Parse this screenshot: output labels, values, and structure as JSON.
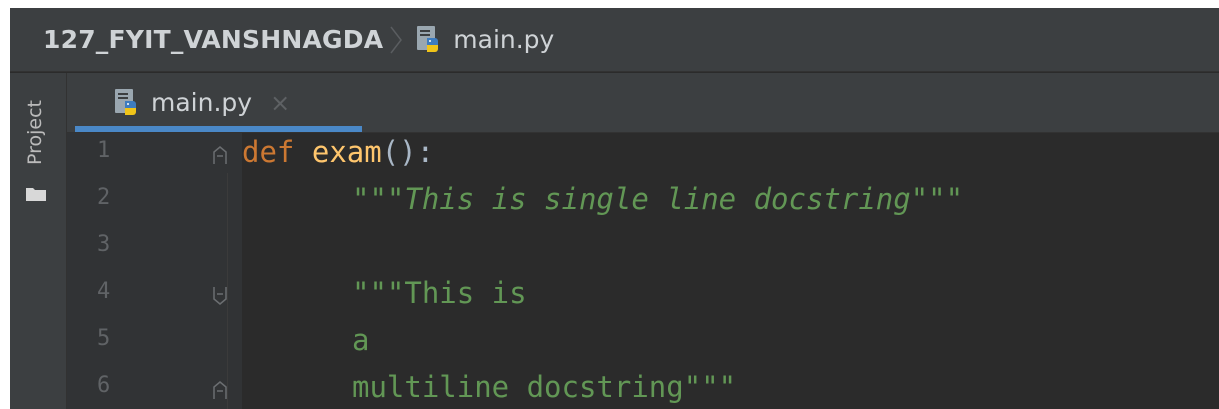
{
  "navbar": {
    "project": "127_FYIT_VANSHNAGDA",
    "file": "main.py",
    "file_icon": "python-file-icon"
  },
  "toolstrip": {
    "project_label": "Project",
    "folder_icon": "folder-icon"
  },
  "tabs": [
    {
      "label": "main.py",
      "icon": "python-file-icon",
      "close": "×"
    }
  ],
  "editor": {
    "lines": [
      {
        "number": "1",
        "segments": [
          {
            "kw": "def"
          },
          {
            "plain": " "
          },
          {
            "fn": "exam"
          },
          {
            "plain": "():"
          }
        ]
      },
      {
        "number": "2",
        "text": "\"\"\"This is single line docstring\"\"\""
      },
      {
        "number": "3",
        "text": ""
      },
      {
        "number": "4",
        "text": "\"\"\"This is"
      },
      {
        "number": "5",
        "text": "a"
      },
      {
        "number": "6",
        "text": "multiline docstring\"\"\""
      }
    ],
    "line1": {
      "kw": "def",
      "fn": "exam",
      "rest": "():"
    }
  },
  "colors": {
    "keyword": "#cc7832",
    "function": "#ffc66d",
    "docstring": "#629755",
    "tab_underline": "#4a88c7"
  }
}
